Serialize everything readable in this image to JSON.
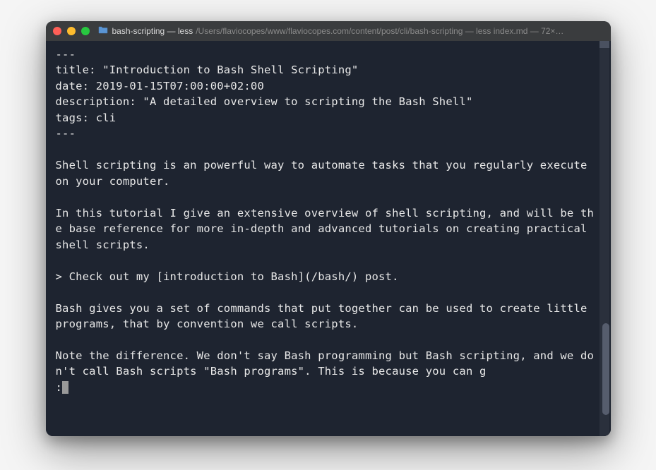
{
  "window": {
    "title_main": "bash-scripting — less",
    "title_sub": "/Users/flaviocopes/www/flaviocopes.com/content/post/cli/bash-scripting — less index.md — 72×…"
  },
  "content": {
    "line1": "---",
    "line2": "title: \"Introduction to Bash Shell Scripting\"",
    "line3": "date: 2019-01-15T07:00:00+02:00",
    "line4": "description: \"A detailed overview to scripting the Bash Shell\"",
    "line5": "tags: cli",
    "line6": "---",
    "blank1": "",
    "para1": "Shell scripting is an powerful way to automate tasks that you regularly execute on your computer.",
    "blank2": "",
    "para2": "In this tutorial I give an extensive overview of shell scripting, and will be the base reference for more in-depth and advanced tutorials on creating practical shell scripts.",
    "blank3": "",
    "para3": "> Check out my [introduction to Bash](/bash/) post.",
    "blank4": "",
    "para4": "Bash gives you a set of commands that put together can be used to create little programs, that by convention we call scripts.",
    "blank5": "",
    "para5": "Note the difference. We don't say Bash programming but Bash scripting, and we don't call Bash scripts \"Bash programs\". This is because you can g",
    "prompt": ":"
  }
}
